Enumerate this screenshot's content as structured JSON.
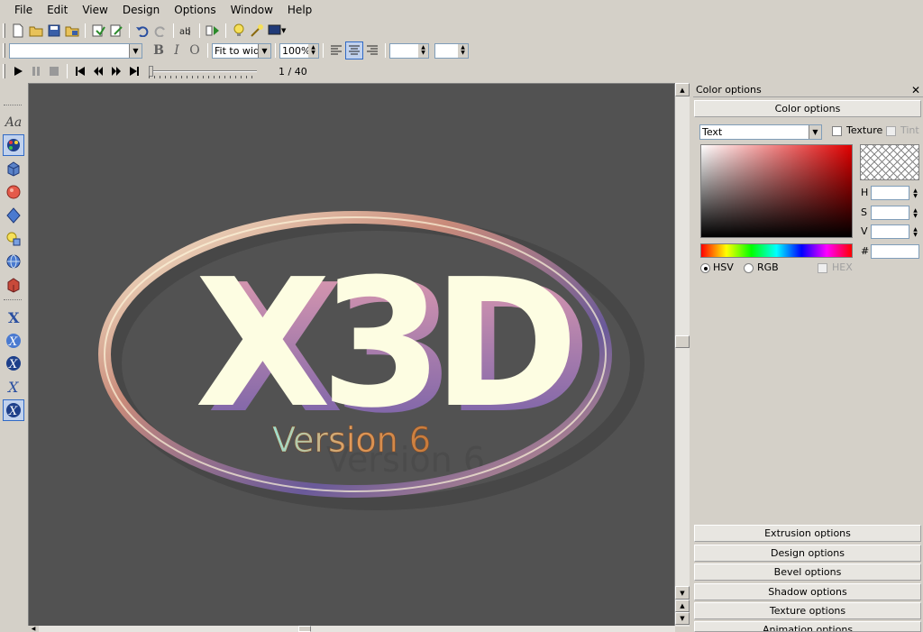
{
  "menu": [
    "File",
    "Edit",
    "View",
    "Design",
    "Options",
    "Window",
    "Help"
  ],
  "toolbar": {
    "font_value": "",
    "bold": "B",
    "italic": "I",
    "outline": "O",
    "fit_option": "Fit to widt",
    "zoom": "100%",
    "frame_counter": "1 / 40"
  },
  "tools": [
    "text-tool",
    "color-tool",
    "extrude-tool",
    "sphere-tool",
    "light-tool",
    "lights-tool",
    "globe-tool",
    "box-tool",
    "x-tool-1",
    "x-tool-2",
    "x-tool-3",
    "x-tool-4",
    "x-tool-5"
  ],
  "tool_text_glyph": "Aa",
  "canvas": {
    "logo_text": "X3D",
    "subtitle": "Version 6",
    "background": "#525252"
  },
  "panel": {
    "title": "Color options",
    "section_title": "Color options",
    "target": "Text",
    "texture_label": "Texture",
    "tint_label": "Tint",
    "h_label": "H",
    "s_label": "S",
    "v_label": "V",
    "hash_label": "#",
    "hsv_label": "HSV",
    "rgb_label": "RGB",
    "hex_label": "HEX",
    "sections": [
      "Extrusion options",
      "Design options",
      "Bevel options",
      "Shadow options",
      "Texture options",
      "Animation options"
    ]
  }
}
